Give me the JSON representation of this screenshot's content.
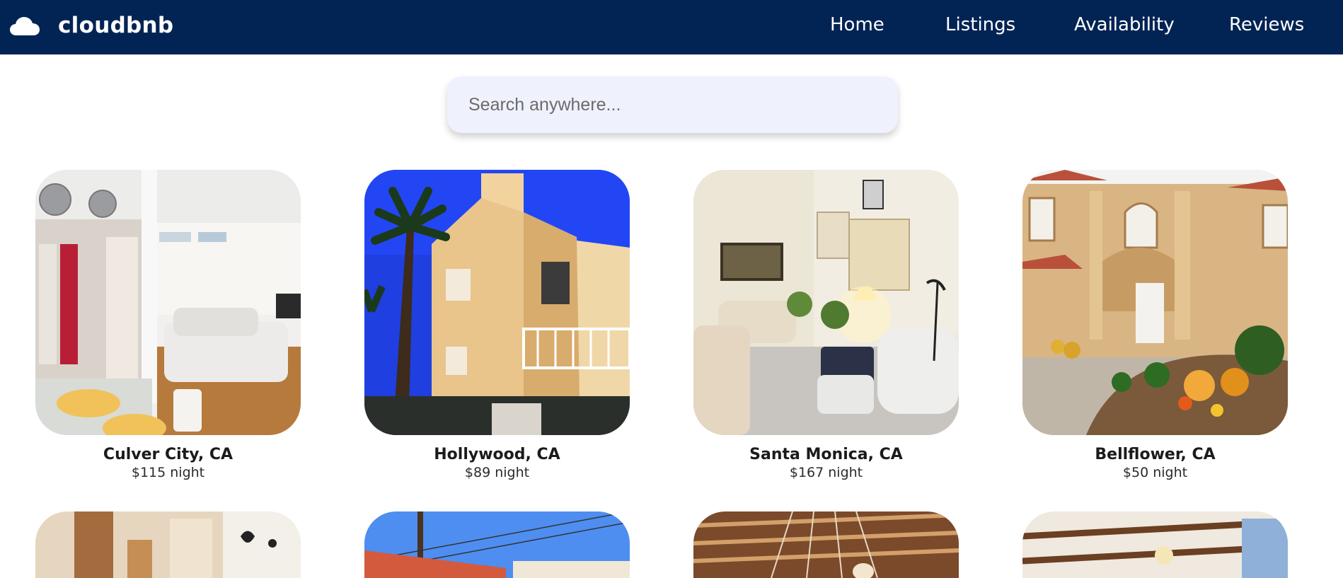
{
  "nav": {
    "brand": "cloudbnb",
    "brand_icon": "cloud-icon",
    "links": [
      "Home",
      "Listings",
      "Availability",
      "Reviews"
    ],
    "colors": {
      "background": "#022454",
      "text": "#ffffff"
    }
  },
  "search": {
    "placeholder": "Search anywhere...",
    "value": ""
  },
  "listings": [
    {
      "location": "Culver City, CA",
      "price": "$115 night"
    },
    {
      "location": "Hollywood, CA",
      "price": "$89 night"
    },
    {
      "location": "Santa Monica, CA",
      "price": "$167 night"
    },
    {
      "location": "Bellflower, CA",
      "price": "$50 night"
    }
  ]
}
